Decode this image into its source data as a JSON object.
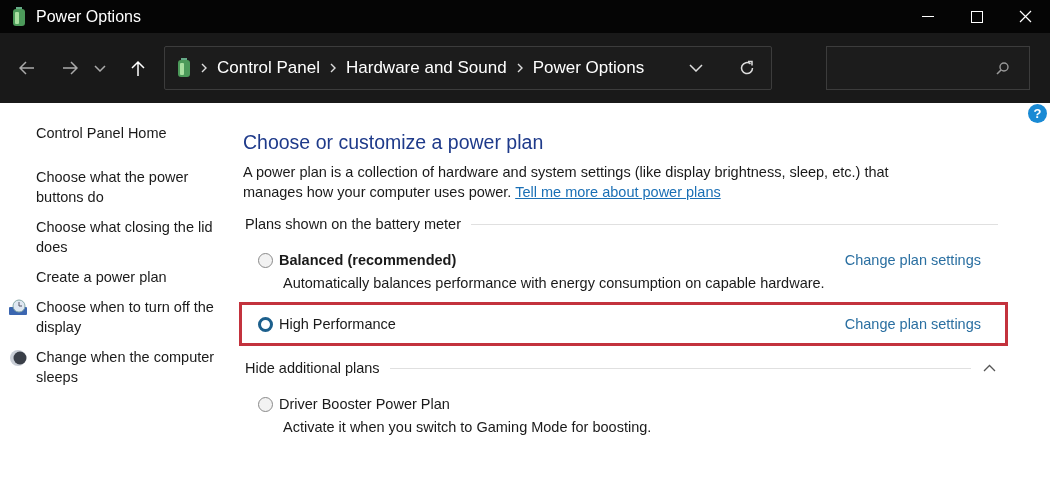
{
  "window": {
    "title": "Power Options"
  },
  "address_bar": {
    "breadcrumbs": [
      "Control Panel",
      "Hardware and Sound",
      "Power Options"
    ]
  },
  "help": {
    "label": "?"
  },
  "sidebar": {
    "items": [
      {
        "label": "Control Panel Home",
        "kind": "home"
      },
      {
        "label": "Choose what the power buttons do",
        "kind": "plain"
      },
      {
        "label": "Choose what closing the lid does",
        "kind": "plain"
      },
      {
        "label": "Create a power plan",
        "kind": "plain"
      },
      {
        "label": "Choose when to turn off the display",
        "kind": "display"
      },
      {
        "label": "Change when the computer sleeps",
        "kind": "sleep"
      }
    ]
  },
  "main": {
    "heading": "Choose or customize a power plan",
    "description": "A power plan is a collection of hardware and system settings (like display brightness, sleep, etc.) that manages how your computer uses power.",
    "link": "Tell me more about power plans",
    "sections": [
      {
        "title": "Plans shown on the battery meter",
        "plans": [
          {
            "name": "Balanced (recommended)",
            "bold": true,
            "selected": false,
            "highlighted": false,
            "link": "Change plan settings",
            "description": "Automatically balances performance with energy consumption on capable hardware."
          },
          {
            "name": "High Performance",
            "bold": false,
            "selected": true,
            "highlighted": true,
            "link": "Change plan settings"
          }
        ]
      },
      {
        "title": "Hide additional plans",
        "expanded": true,
        "plans": [
          {
            "name": "Driver Booster Power Plan",
            "bold": false,
            "selected": false,
            "highlighted": false,
            "description": "Activate it when you switch to Gaming Mode for boosting."
          }
        ]
      }
    ]
  }
}
